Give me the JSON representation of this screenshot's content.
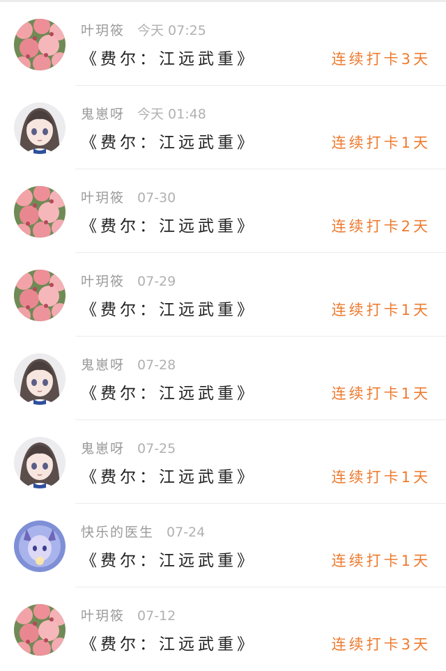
{
  "colors": {
    "streak": "#ee7a2e",
    "meta": "#9a9a9a",
    "title": "#222222"
  },
  "entries": [
    {
      "user": "叶玥筱",
      "time": "今天 07:25",
      "book": "《费尔：江远武重》",
      "streak": "连续打卡3天",
      "avatar": "flowers-avatar"
    },
    {
      "user": "鬼崽呀",
      "time": "今天 01:48",
      "book": "《费尔：江远武重》",
      "streak": "连续打卡1天",
      "avatar": "anime-girl-avatar"
    },
    {
      "user": "叶玥筱",
      "time": "07-30",
      "book": "《费尔：江远武重》",
      "streak": "连续打卡2天",
      "avatar": "flowers-avatar"
    },
    {
      "user": "叶玥筱",
      "time": "07-29",
      "book": "《费尔：江远武重》",
      "streak": "连续打卡1天",
      "avatar": "flowers-avatar"
    },
    {
      "user": "鬼崽呀",
      "time": "07-28",
      "book": "《费尔：江远武重》",
      "streak": "连续打卡1天",
      "avatar": "anime-girl-avatar"
    },
    {
      "user": "鬼崽呀",
      "time": "07-25",
      "book": "《费尔：江远武重》",
      "streak": "连续打卡1天",
      "avatar": "anime-girl-avatar"
    },
    {
      "user": "快乐的医生",
      "time": "07-24",
      "book": "《费尔：江远武重》",
      "streak": "连续打卡1天",
      "avatar": "blue-character-avatar"
    },
    {
      "user": "叶玥筱",
      "time": "07-12",
      "book": "《费尔：江远武重》",
      "streak": "连续打卡3天",
      "avatar": "flowers-avatar"
    }
  ]
}
